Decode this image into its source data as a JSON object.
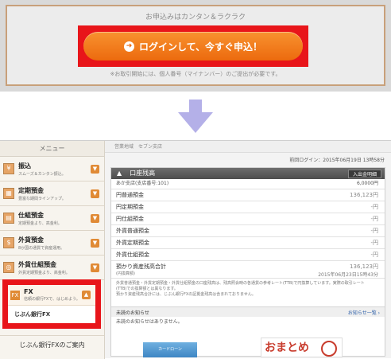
{
  "banner": {
    "tagline": "お申込みはカンタン＆ラクラク",
    "login_button": "ログインして、今すぐ申込！",
    "note": "※お取引開始には、個人番号（マイナンバー）のご提出が必要です。"
  },
  "colors": {
    "highlight": "#e8151a",
    "login_button": "#ec6a0e",
    "menu_accent": "#e08a35"
  },
  "sidebar": {
    "header": "メニュー",
    "items": [
      {
        "title": "振込",
        "subtitle": "スムーズ＆カンタン振込。"
      },
      {
        "title": "定期預金",
        "subtitle": "豊富な期間ラインアップ。"
      },
      {
        "title": "仕組預金",
        "subtitle": "定期預金より、高金利。"
      },
      {
        "title": "外貨預金",
        "subtitle": "8か国の通貨で資産運用。"
      },
      {
        "title": "外貨仕組預金",
        "subtitle": "外貨定期預金より、高金利。"
      }
    ],
    "fx_item": {
      "title": "FX",
      "subtitle": "信頼の銀行FXで、はじめよう。"
    },
    "fx_link": "じぶん銀行FX",
    "guide": "じぶん銀行FXのご案内"
  },
  "main": {
    "breadcrumb": "営業地域　セブン支店",
    "last_login": "前回ログイン：2015年06月19日 13時58分",
    "panel_title": "口座残高",
    "panel_button": "入出金明細",
    "branch_label": "あか支店(支店番号:101)",
    "branch_value": "6,0000円",
    "rows": [
      {
        "label": "円普通預金",
        "amount": "136,123円"
      },
      {
        "label": "円定期預金",
        "amount": "-円"
      },
      {
        "label": "円仕組預金",
        "amount": "-円"
      },
      {
        "label": "外貨普通預金",
        "amount": "-円"
      },
      {
        "label": "外貨定期預金",
        "amount": "-円"
      },
      {
        "label": "外貨仕組預金",
        "amount": "-円"
      }
    ],
    "total_label": "預かり資産残高合計",
    "total_sub": "(円換算額)",
    "total_amount": "136,123円",
    "total_timestamp": "2015年06月23日15時43分",
    "notes": [
      "外貨普通預金・外貨定期預金・外貨仕組預金の口座残高は、残高照会時の各通貨の参考レート(TTB)で円換算しています。実際の取引レート",
      "(TTB)での換算額とは異なります。",
      "預かり資産残高合計には、じぶん銀行FXの証拠金残高は含まれておりません。"
    ],
    "notice_heading": "未読のお知らせ",
    "notice_link": "お知らせ一覧 ›",
    "notice_body": "未読のお知らせはありません。",
    "ad_left": "カードローン",
    "ad_right": "おまとめ"
  }
}
